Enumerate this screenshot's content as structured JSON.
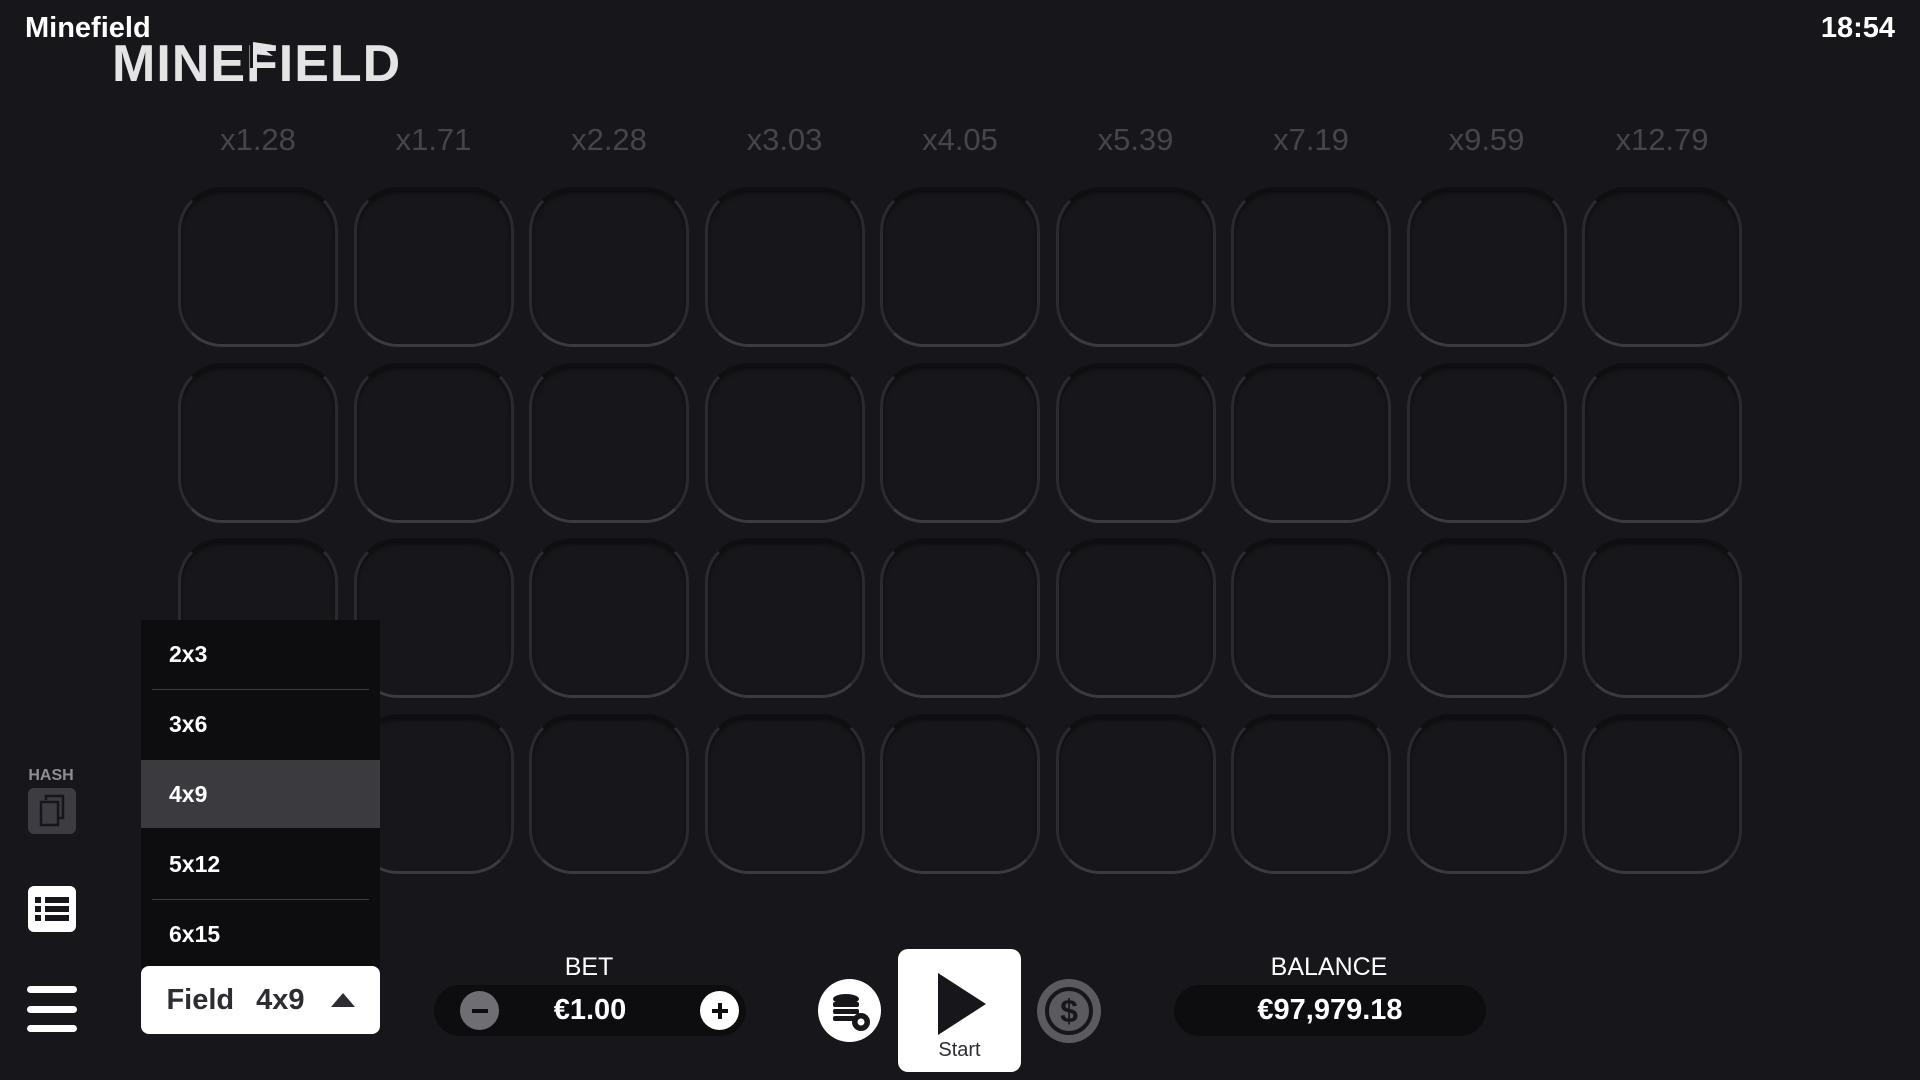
{
  "header": {
    "app_title": "Minefield",
    "clock": "18:54",
    "logo_text": "MINEFIELD"
  },
  "multipliers": [
    "x1.28",
    "x1.71",
    "x2.28",
    "x3.03",
    "x4.05",
    "x5.39",
    "x7.19",
    "x9.59",
    "x12.79"
  ],
  "grid": {
    "rows": 4,
    "cols": 9
  },
  "tools": {
    "hash_label": "HASH"
  },
  "field_select": {
    "label": "Field",
    "value": "4x9",
    "options": [
      "2x3",
      "3x6",
      "4x9",
      "5x12",
      "6x15"
    ],
    "selected": "4x9"
  },
  "bet": {
    "label": "BET",
    "value": "€1.00"
  },
  "start": {
    "label": "Start"
  },
  "balance": {
    "label": "BALANCE",
    "value": "€97,979.18"
  },
  "colors": {
    "background": "#17171b",
    "panel": "#0d0d10",
    "multiplier_text": "#45454d",
    "cell_border": "#2a2a2f",
    "selected_option": "#3a3a3f"
  }
}
